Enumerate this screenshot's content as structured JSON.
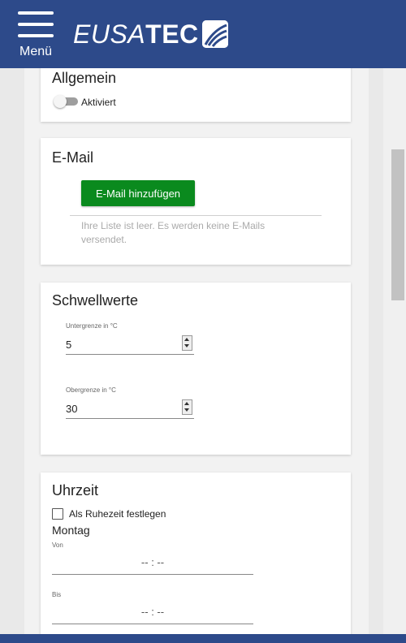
{
  "header": {
    "menu_label": "Menü",
    "logo_text_italic": "EUSA",
    "logo_text_bold": "TEC",
    "logo_icon": "eusatec-wave-logo-icon",
    "background_color": "#2d4a8a"
  },
  "general": {
    "title": "Allgemein",
    "toggle_label": "Aktiviert",
    "toggle_on": false
  },
  "email": {
    "title": "E-Mail",
    "add_button_label": "E-Mail hinzufügen",
    "add_button_color": "#0a8a1e",
    "empty_message": "Ihre Liste ist leer. Es werden keine E-Mails versendet."
  },
  "thresholds": {
    "title": "Schwellwerte",
    "lower_label": "Untergrenze in °C",
    "lower_value": "5",
    "upper_label": "Obergrenze in °C",
    "upper_value": "30"
  },
  "time": {
    "title": "Uhrzeit",
    "quiet_time_label": "Als Ruhezeit festlegen",
    "quiet_time_checked": false,
    "day_label": "Montag",
    "from_label": "Von",
    "from_value": "-- : --",
    "to_label": "Bis",
    "to_value": "-- : --"
  }
}
